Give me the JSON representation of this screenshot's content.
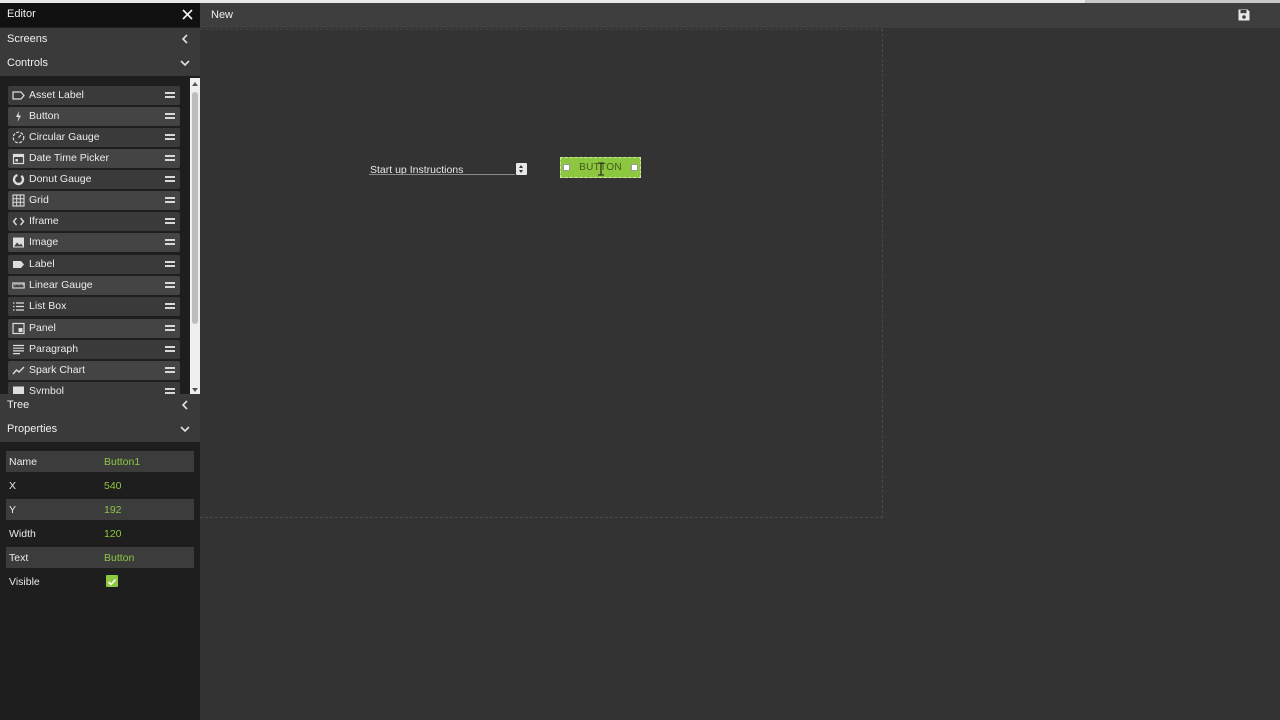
{
  "sidebar": {
    "title": "Editor",
    "sections": {
      "screens": "Screens",
      "controls": "Controls",
      "tree": "Tree",
      "properties": "Properties"
    },
    "controls": [
      {
        "label": "Asset Label",
        "icon": "tag-outline-icon"
      },
      {
        "label": "Button",
        "icon": "lightning-icon"
      },
      {
        "label": "Circular Gauge",
        "icon": "gauge-icon"
      },
      {
        "label": "Date Time Picker",
        "icon": "calendar-icon"
      },
      {
        "label": "Donut Gauge",
        "icon": "donut-icon"
      },
      {
        "label": "Grid",
        "icon": "grid-icon"
      },
      {
        "label": "Iframe",
        "icon": "code-brackets-icon"
      },
      {
        "label": "Image",
        "icon": "image-icon"
      },
      {
        "label": "Label",
        "icon": "tag-icon"
      },
      {
        "label": "Linear Gauge",
        "icon": "ruler-icon"
      },
      {
        "label": "List Box",
        "icon": "list-icon"
      },
      {
        "label": "Panel",
        "icon": "panel-icon"
      },
      {
        "label": "Paragraph",
        "icon": "paragraph-icon"
      },
      {
        "label": "Spark Chart",
        "icon": "trend-line-icon"
      },
      {
        "label": "Symbol",
        "icon": "symbol-icon"
      }
    ],
    "properties": [
      {
        "key": "Name",
        "value": "Button1"
      },
      {
        "key": "X",
        "value": "540"
      },
      {
        "key": "Y",
        "value": "192"
      },
      {
        "key": "Width",
        "value": "120"
      },
      {
        "key": "Text",
        "value": "Button"
      },
      {
        "key": "Visible",
        "value": true
      }
    ]
  },
  "topbar": {
    "title": "New"
  },
  "canvas": {
    "label_widget": "Start up Instructions",
    "button_widget": "BUTTON"
  },
  "colors": {
    "accent": "#8dc63f",
    "sidebar_bg": "#1e1e1e",
    "canvas_bg": "#333333"
  }
}
